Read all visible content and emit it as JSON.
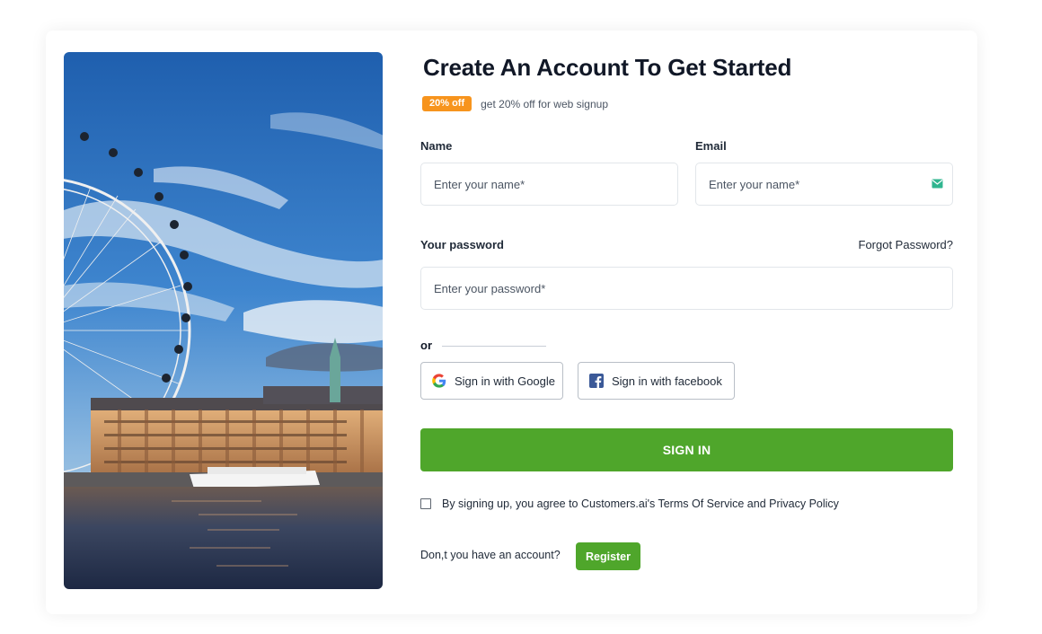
{
  "form": {
    "title": "Create An Account To Get Started",
    "promo_badge": "20% off",
    "promo_text": "get 20% off for web signup",
    "name_label": "Name",
    "name_placeholder": "Enter your name*",
    "email_label": "Email",
    "email_placeholder": "Enter your name*",
    "password_label": "Your password",
    "forgot_password": "Forgot Password?",
    "password_placeholder": "Enter your password*",
    "or_text": "or",
    "google_button": "Sign in with Google",
    "facebook_button": "Sign in with facebook",
    "sign_in_button": "SIGN IN",
    "terms_text": "By signing up, you agree to Customers.ai's Terms Of Service and Privacy Policy",
    "no_account_text": "Don,t you have an account?",
    "register_button": "Register"
  },
  "colors": {
    "primary_green": "#4fa62b",
    "badge_orange": "#f7941d",
    "text_dark": "#111827",
    "border": "#e2e6ea"
  },
  "icons": [
    "mail-icon",
    "google-icon",
    "facebook-icon"
  ]
}
